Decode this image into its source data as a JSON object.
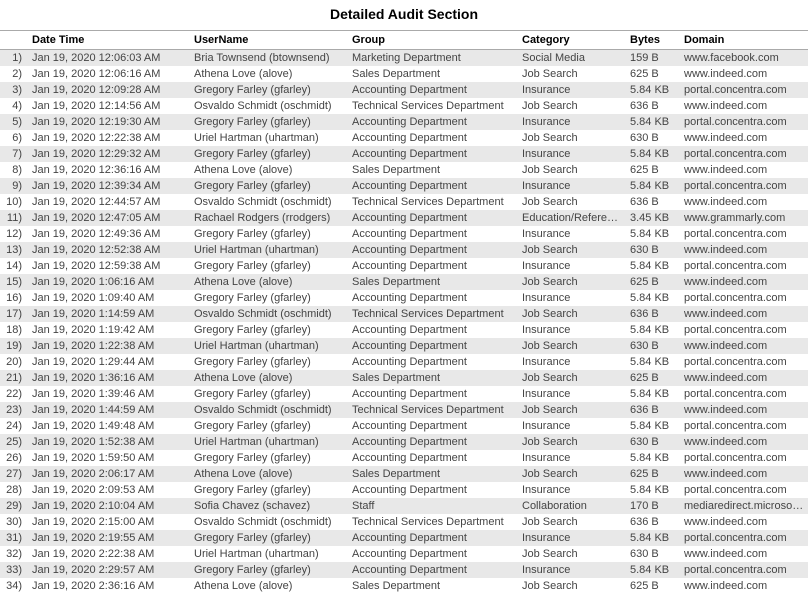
{
  "title": "Detailed Audit Section",
  "columns": {
    "datetime": "Date Time",
    "username": "UserName",
    "group": "Group",
    "category": "Category",
    "bytes": "Bytes",
    "domain": "Domain"
  },
  "rows": [
    {
      "idx": "1)",
      "datetime": "Jan 19, 2020 12:06:03 AM",
      "username": "Bria Townsend (btownsend)",
      "group": "Marketing Department",
      "category": "Social Media",
      "bytes": "159 B",
      "domain": "www.facebook.com"
    },
    {
      "idx": "2)",
      "datetime": "Jan 19, 2020 12:06:16 AM",
      "username": "Athena Love (alove)",
      "group": "Sales Department",
      "category": "Job Search",
      "bytes": "625 B",
      "domain": "www.indeed.com"
    },
    {
      "idx": "3)",
      "datetime": "Jan 19, 2020 12:09:28 AM",
      "username": "Gregory Farley (gfarley)",
      "group": "Accounting Department",
      "category": "Insurance",
      "bytes": "5.84 KB",
      "domain": "portal.concentra.com"
    },
    {
      "idx": "4)",
      "datetime": "Jan 19, 2020 12:14:56 AM",
      "username": "Osvaldo Schmidt (oschmidt)",
      "group": "Technical Services Department",
      "category": "Job Search",
      "bytes": "636 B",
      "domain": "www.indeed.com"
    },
    {
      "idx": "5)",
      "datetime": "Jan 19, 2020 12:19:30 AM",
      "username": "Gregory Farley (gfarley)",
      "group": "Accounting Department",
      "category": "Insurance",
      "bytes": "5.84 KB",
      "domain": "portal.concentra.com"
    },
    {
      "idx": "6)",
      "datetime": "Jan 19, 2020 12:22:38 AM",
      "username": "Uriel Hartman (uhartman)",
      "group": "Accounting Department",
      "category": "Job Search",
      "bytes": "630 B",
      "domain": "www.indeed.com"
    },
    {
      "idx": "7)",
      "datetime": "Jan 19, 2020 12:29:32 AM",
      "username": "Gregory Farley (gfarley)",
      "group": "Accounting Department",
      "category": "Insurance",
      "bytes": "5.84 KB",
      "domain": "portal.concentra.com"
    },
    {
      "idx": "8)",
      "datetime": "Jan 19, 2020 12:36:16 AM",
      "username": "Athena Love (alove)",
      "group": "Sales Department",
      "category": "Job Search",
      "bytes": "625 B",
      "domain": "www.indeed.com"
    },
    {
      "idx": "9)",
      "datetime": "Jan 19, 2020 12:39:34 AM",
      "username": "Gregory Farley (gfarley)",
      "group": "Accounting Department",
      "category": "Insurance",
      "bytes": "5.84 KB",
      "domain": "portal.concentra.com"
    },
    {
      "idx": "10)",
      "datetime": "Jan 19, 2020 12:44:57 AM",
      "username": "Osvaldo Schmidt (oschmidt)",
      "group": "Technical Services Department",
      "category": "Job Search",
      "bytes": "636 B",
      "domain": "www.indeed.com"
    },
    {
      "idx": "11)",
      "datetime": "Jan 19, 2020 12:47:05 AM",
      "username": "Rachael Rodgers (rrodgers)",
      "group": "Accounting Department",
      "category": "Education/Reference",
      "bytes": "3.45 KB",
      "domain": "www.grammarly.com"
    },
    {
      "idx": "12)",
      "datetime": "Jan 19, 2020 12:49:36 AM",
      "username": "Gregory Farley (gfarley)",
      "group": "Accounting Department",
      "category": "Insurance",
      "bytes": "5.84 KB",
      "domain": "portal.concentra.com"
    },
    {
      "idx": "13)",
      "datetime": "Jan 19, 2020 12:52:38 AM",
      "username": "Uriel Hartman (uhartman)",
      "group": "Accounting Department",
      "category": "Job Search",
      "bytes": "630 B",
      "domain": "www.indeed.com"
    },
    {
      "idx": "14)",
      "datetime": "Jan 19, 2020 12:59:38 AM",
      "username": "Gregory Farley (gfarley)",
      "group": "Accounting Department",
      "category": "Insurance",
      "bytes": "5.84 KB",
      "domain": "portal.concentra.com"
    },
    {
      "idx": "15)",
      "datetime": "Jan 19, 2020 1:06:16 AM",
      "username": "Athena Love (alove)",
      "group": "Sales Department",
      "category": "Job Search",
      "bytes": "625 B",
      "domain": "www.indeed.com"
    },
    {
      "idx": "16)",
      "datetime": "Jan 19, 2020 1:09:40 AM",
      "username": "Gregory Farley (gfarley)",
      "group": "Accounting Department",
      "category": "Insurance",
      "bytes": "5.84 KB",
      "domain": "portal.concentra.com"
    },
    {
      "idx": "17)",
      "datetime": "Jan 19, 2020 1:14:59 AM",
      "username": "Osvaldo Schmidt (oschmidt)",
      "group": "Technical Services Department",
      "category": "Job Search",
      "bytes": "636 B",
      "domain": "www.indeed.com"
    },
    {
      "idx": "18)",
      "datetime": "Jan 19, 2020 1:19:42 AM",
      "username": "Gregory Farley (gfarley)",
      "group": "Accounting Department",
      "category": "Insurance",
      "bytes": "5.84 KB",
      "domain": "portal.concentra.com"
    },
    {
      "idx": "19)",
      "datetime": "Jan 19, 2020 1:22:38 AM",
      "username": "Uriel Hartman (uhartman)",
      "group": "Accounting Department",
      "category": "Job Search",
      "bytes": "630 B",
      "domain": "www.indeed.com"
    },
    {
      "idx": "20)",
      "datetime": "Jan 19, 2020 1:29:44 AM",
      "username": "Gregory Farley (gfarley)",
      "group": "Accounting Department",
      "category": "Insurance",
      "bytes": "5.84 KB",
      "domain": "portal.concentra.com"
    },
    {
      "idx": "21)",
      "datetime": "Jan 19, 2020 1:36:16 AM",
      "username": "Athena Love (alove)",
      "group": "Sales Department",
      "category": "Job Search",
      "bytes": "625 B",
      "domain": "www.indeed.com"
    },
    {
      "idx": "22)",
      "datetime": "Jan 19, 2020 1:39:46 AM",
      "username": "Gregory Farley (gfarley)",
      "group": "Accounting Department",
      "category": "Insurance",
      "bytes": "5.84 KB",
      "domain": "portal.concentra.com"
    },
    {
      "idx": "23)",
      "datetime": "Jan 19, 2020 1:44:59 AM",
      "username": "Osvaldo Schmidt (oschmidt)",
      "group": "Technical Services Department",
      "category": "Job Search",
      "bytes": "636 B",
      "domain": "www.indeed.com"
    },
    {
      "idx": "24)",
      "datetime": "Jan 19, 2020 1:49:48 AM",
      "username": "Gregory Farley (gfarley)",
      "group": "Accounting Department",
      "category": "Insurance",
      "bytes": "5.84 KB",
      "domain": "portal.concentra.com"
    },
    {
      "idx": "25)",
      "datetime": "Jan 19, 2020 1:52:38 AM",
      "username": "Uriel Hartman (uhartman)",
      "group": "Accounting Department",
      "category": "Job Search",
      "bytes": "630 B",
      "domain": "www.indeed.com"
    },
    {
      "idx": "26)",
      "datetime": "Jan 19, 2020 1:59:50 AM",
      "username": "Gregory Farley (gfarley)",
      "group": "Accounting Department",
      "category": "Insurance",
      "bytes": "5.84 KB",
      "domain": "portal.concentra.com"
    },
    {
      "idx": "27)",
      "datetime": "Jan 19, 2020 2:06:17 AM",
      "username": "Athena Love (alove)",
      "group": "Sales Department",
      "category": "Job Search",
      "bytes": "625 B",
      "domain": "www.indeed.com"
    },
    {
      "idx": "28)",
      "datetime": "Jan 19, 2020 2:09:53 AM",
      "username": "Gregory Farley (gfarley)",
      "group": "Accounting Department",
      "category": "Insurance",
      "bytes": "5.84 KB",
      "domain": "portal.concentra.com"
    },
    {
      "idx": "29)",
      "datetime": "Jan 19, 2020 2:10:04 AM",
      "username": "Sofia Chavez (schavez)",
      "group": "Staff",
      "category": "Collaboration",
      "bytes": "170 B",
      "domain": "mediaredirect.microsoft.com"
    },
    {
      "idx": "30)",
      "datetime": "Jan 19, 2020 2:15:00 AM",
      "username": "Osvaldo Schmidt (oschmidt)",
      "group": "Technical Services Department",
      "category": "Job Search",
      "bytes": "636 B",
      "domain": "www.indeed.com"
    },
    {
      "idx": "31)",
      "datetime": "Jan 19, 2020 2:19:55 AM",
      "username": "Gregory Farley (gfarley)",
      "group": "Accounting Department",
      "category": "Insurance",
      "bytes": "5.84 KB",
      "domain": "portal.concentra.com"
    },
    {
      "idx": "32)",
      "datetime": "Jan 19, 2020 2:22:38 AM",
      "username": "Uriel Hartman (uhartman)",
      "group": "Accounting Department",
      "category": "Job Search",
      "bytes": "630 B",
      "domain": "www.indeed.com"
    },
    {
      "idx": "33)",
      "datetime": "Jan 19, 2020 2:29:57 AM",
      "username": "Gregory Farley (gfarley)",
      "group": "Accounting Department",
      "category": "Insurance",
      "bytes": "5.84 KB",
      "domain": "portal.concentra.com"
    },
    {
      "idx": "34)",
      "datetime": "Jan 19, 2020 2:36:16 AM",
      "username": "Athena Love (alove)",
      "group": "Sales Department",
      "category": "Job Search",
      "bytes": "625 B",
      "domain": "www.indeed.com"
    }
  ]
}
